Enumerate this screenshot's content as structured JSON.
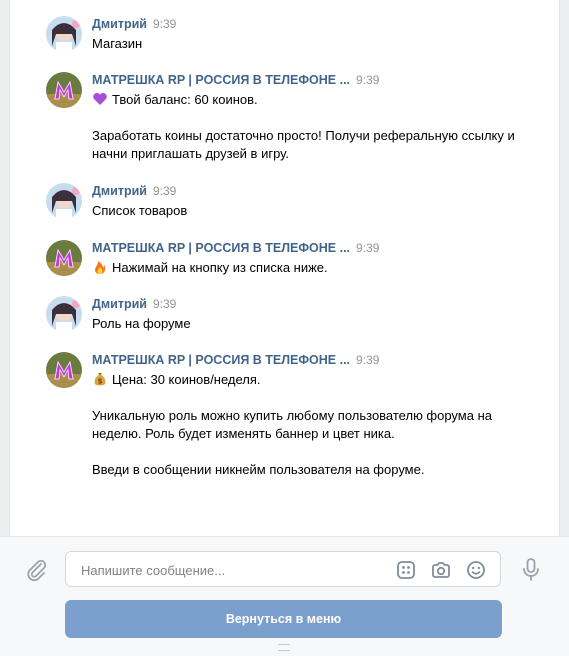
{
  "messages": [
    {
      "author": "Дмитрий",
      "time": "9:39",
      "avatar": "user",
      "lines": "Магазин"
    },
    {
      "author": "МАТРЕШКА RP | РОССИЯ В ТЕЛЕФОНЕ ...",
      "time": "9:39",
      "avatar": "bot",
      "emoji": "purple-heart",
      "lines": "Твой баланс: 60 коинов.\n\nЗаработать коины достаточно просто! Получи реферальную ссылку и начни приглашать друзей в игру."
    },
    {
      "author": "Дмитрий",
      "time": "9:39",
      "avatar": "user",
      "lines": "Список товаров"
    },
    {
      "author": "МАТРЕШКА RP | РОССИЯ В ТЕЛЕФОНЕ ...",
      "time": "9:39",
      "avatar": "bot",
      "emoji": "fire",
      "lines": "Нажимай на кнопку из списка ниже."
    },
    {
      "author": "Дмитрий",
      "time": "9:39",
      "avatar": "user",
      "lines": "Роль на форуме"
    },
    {
      "author": "МАТРЕШКА RP | РОССИЯ В ТЕЛЕФОНЕ ...",
      "time": "9:39",
      "avatar": "bot",
      "emoji": "money-bag",
      "lines": "Цена: 30 коинов/неделя.\n\nУникальную роль можно купить любому пользователю форума на неделю. Роль будет изменять баннер и цвет ника.\n\nВведи в сообщении никнейм пользователя на форуме."
    }
  ],
  "composer": {
    "placeholder": "Напишите сообщение...",
    "menu_button": "Вернуться в меню"
  },
  "icons": {
    "attach": "paperclip-icon",
    "keyboard": "bot-keyboard-icon",
    "camera": "camera-icon",
    "smile": "emoji-icon",
    "mic": "microphone-icon"
  },
  "colors": {
    "author": "#42648b",
    "time": "#939393",
    "button": "#7b9fcc",
    "background": "#edeef0"
  }
}
